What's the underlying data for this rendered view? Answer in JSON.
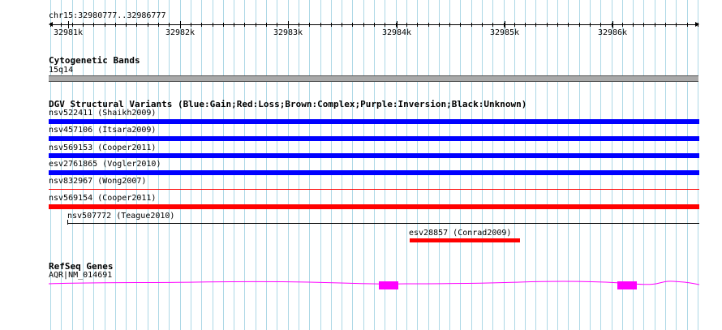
{
  "ruler": {
    "position_label": "chr15:32980777..32986777",
    "tick_labels": [
      "32981k",
      "32982k",
      "32983k",
      "32984k",
      "32985k",
      "32986k"
    ]
  },
  "cytogenetic_bands": {
    "title": "Cytogenetic Bands",
    "band_label": "15q14"
  },
  "dgv": {
    "title": "DGV Structural Variants (Blue:Gain;Red:Loss;Brown:Complex;Purple:Inversion;Black:Unknown)",
    "variants": [
      {
        "label": "nsv522411 (Shaikh2009)",
        "color": "blue"
      },
      {
        "label": "nsv457106 (Itsara2009)",
        "color": "blue"
      },
      {
        "label": "nsv569153 (Cooper2011)",
        "color": "blue"
      },
      {
        "label": "esv2761865 (Vogler2010)",
        "color": "blue"
      },
      {
        "label": "nsv832967 (Wong2007)",
        "color": "red"
      },
      {
        "label": "nsv569154 (Cooper2011)",
        "color": "red"
      },
      {
        "label": "nsv507772 (Teague2010)",
        "color": "black"
      },
      {
        "label": "esv28857 (Conrad2009)",
        "color": "red"
      }
    ]
  },
  "refseq": {
    "title": "RefSeq Genes",
    "gene_label": "AQR|NM_014691"
  },
  "colors": {
    "grid": "#add8e6",
    "gain": "#0000ff",
    "loss": "#ff0000",
    "gene": "#ff00ff",
    "band": "#a9a9a9"
  }
}
